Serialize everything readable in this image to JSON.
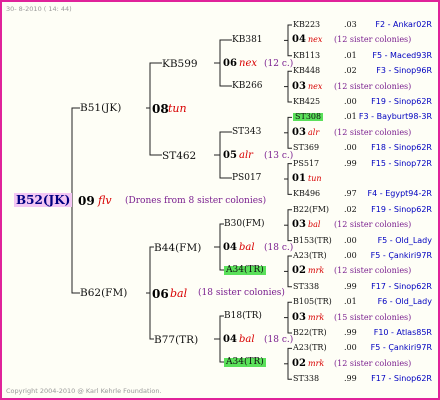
{
  "header": "30-  8-2010 ( 14: 44)",
  "copyright": "Copyright 2004-2010 @ Karl Kehrle Foundation.",
  "root": {
    "id": "B52(JK)",
    "num": "09",
    "race": "flv",
    "note": "(Drones from 8 sister colonies)"
  },
  "gen1": [
    {
      "id": "B51(JK)",
      "num": "08",
      "race": "tun",
      "note": ""
    },
    {
      "id": "B62(FM)",
      "num": "06",
      "race": "bal",
      "note": "(18 sister colonies)"
    }
  ],
  "gen2": [
    {
      "id": "KB599",
      "num": "06",
      "race": "nex",
      "note": "(12 c.)"
    },
    {
      "id": "ST462",
      "num": "05",
      "race": "alr",
      "note": "(13 c.)"
    },
    {
      "id": "B44(FM)",
      "num": "04",
      "race": "bal",
      "note": "(18 c.)"
    },
    {
      "id": "B77(TR)",
      "num": "04",
      "race": "bal",
      "note": "(18 c.)"
    }
  ],
  "gen3": [
    {
      "id": "KB381"
    },
    {
      "id": "KB266"
    },
    {
      "id": "ST343"
    },
    {
      "id": "PS017"
    },
    {
      "id": "B30(FM)"
    },
    {
      "id": "A34(TR)"
    },
    {
      "id": "B18(TR)"
    },
    {
      "id": "A34(TR)"
    }
  ],
  "gen4": [
    {
      "id": "KB223",
      "val": ".03",
      "ref": "F2 - Ankar02R"
    },
    {
      "num": "04",
      "race": "nex",
      "note": "(12 sister colonies)"
    },
    {
      "id": "KB113",
      "val": ".01",
      "ref": "F5 - Maced93R"
    },
    {
      "id": "KB448",
      "val": ".02",
      "ref": "F3 - Sinop96R"
    },
    {
      "num": "03",
      "race": "nex",
      "note": "(12 sister colonies)"
    },
    {
      "id": "KB425",
      "val": ".00",
      "ref": "F19 - Sinop62R"
    },
    {
      "id": "ST308",
      "val": ".01",
      "ref": "F3 - Bayburt98-3R"
    },
    {
      "num": "03",
      "race": "alr",
      "note": "(12 sister colonies)"
    },
    {
      "id": "ST369",
      "val": ".00",
      "ref": "F18 - Sinop62R"
    },
    {
      "id": "PS517",
      "val": ".99",
      "ref": "F15 - Sinop72R"
    },
    {
      "num": "01",
      "race": "tun",
      "note": ""
    },
    {
      "id": "KB496",
      "val": ".97",
      "ref": "F4 - Egypt94-2R"
    },
    {
      "id": "B22(FM)",
      "val": ".02",
      "ref": "F19 - Sinop62R"
    },
    {
      "num": "03",
      "race": "bal",
      "note": "(12 sister colonies)"
    },
    {
      "id": "B153(TR)",
      "val": ".00",
      "ref": "F5 - Old_Lady"
    },
    {
      "id": "A23(TR)",
      "val": ".00",
      "ref": "F5 - Çankiri97R"
    },
    {
      "num": "02",
      "race": "mrk",
      "note": "(12 sister colonies)"
    },
    {
      "id": "ST338",
      "val": ".99",
      "ref": "F17 - Sinop62R"
    },
    {
      "id": "B105(TR)",
      "val": ".01",
      "ref": "F6 - Old_Lady"
    },
    {
      "num": "03",
      "race": "mrk",
      "note": "(15 sister colonies)"
    },
    {
      "id": "B22(TR)",
      "val": ".99",
      "ref": "F10 - Atlas85R"
    },
    {
      "id": "A23(TR)",
      "val": ".00",
      "ref": "F5 - Çankiri97R"
    },
    {
      "num": "02",
      "race": "mrk",
      "note": "(12 sister colonies)"
    },
    {
      "id": "ST338",
      "val": ".99",
      "ref": "F17 - Sinop62R"
    }
  ]
}
